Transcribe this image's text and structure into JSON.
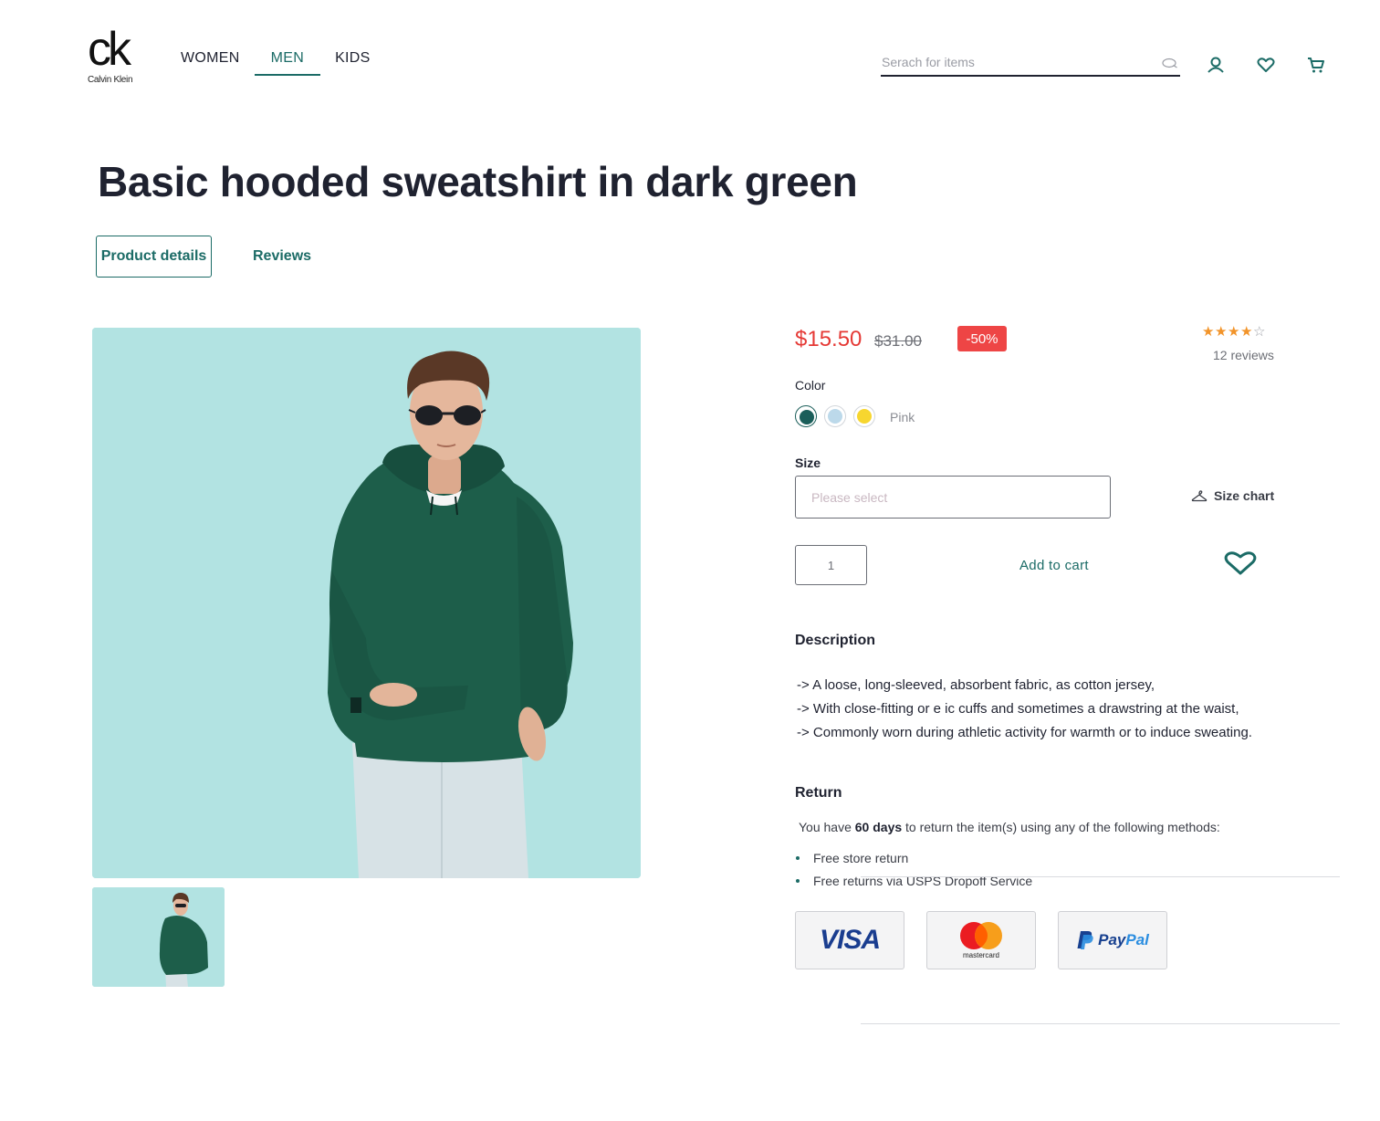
{
  "brand": {
    "mark": "ck",
    "name": "Calvin Klein"
  },
  "nav": {
    "items": [
      "WOMEN",
      "MEN",
      "KIDS"
    ],
    "active": "MEN"
  },
  "search": {
    "placeholder": "Serach for items"
  },
  "header_icons": [
    "user-icon",
    "heart-icon",
    "cart-icon"
  ],
  "product": {
    "title": "Basic hooded sweatshirt in dark green",
    "price": "$15.50",
    "old_price": "$31.00",
    "discount": "-50%",
    "rating": 4,
    "rating_max": 5,
    "reviews_count": "12 reviews"
  },
  "tabs": {
    "details": "Product details",
    "reviews": "Reviews"
  },
  "color": {
    "label": "Color",
    "selected_name": "Pink",
    "swatches": [
      "#1b5e5a",
      "#bcd9ea",
      "#f7d62f"
    ]
  },
  "size": {
    "label": "Size",
    "placeholder": "Please select",
    "chart_label": "Size chart"
  },
  "cart": {
    "quantity": "1",
    "add_label": "Add to cart"
  },
  "description": {
    "heading": "Description",
    "lines": [
      "-> A loose, long-sleeved, absorbent fabric, as cotton jersey,",
      "-> With close-fitting or e ic cuffs and sometimes a drawstring at the waist,",
      "-> Commonly worn during athletic activity for warmth or to induce sweating."
    ]
  },
  "returns": {
    "heading": "Return",
    "text_before": "You have ",
    "days": "60 days",
    "text_after": " to return the item(s) using any of the following methods:",
    "methods": [
      "Free store return",
      "Free returns via USPS Dropoff Service"
    ]
  },
  "payment": {
    "visa": "VISA",
    "mastercard": "mastercard",
    "paypal_a": "Pay",
    "paypal_b": "Pal"
  },
  "colors": {
    "accent": "#1b6b66",
    "sale": "#e53935",
    "badge": "#ee4545",
    "image_bg": "#b2e3e2",
    "hoodie": "#1d5e4a"
  }
}
